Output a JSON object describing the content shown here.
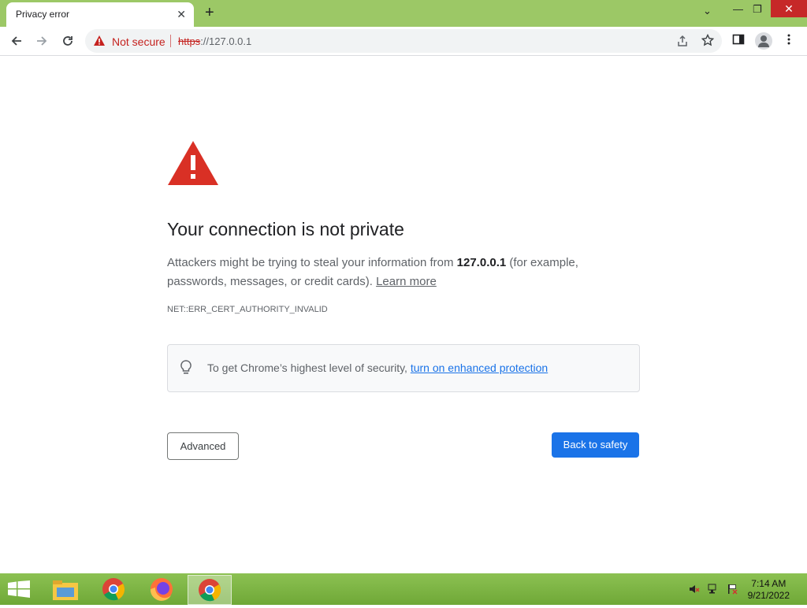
{
  "tab": {
    "title": "Privacy error",
    "close": "✕"
  },
  "new_tab": "+",
  "window": {
    "dropdown": "⌄",
    "minimize": "—",
    "restore": "❐",
    "close": "✕"
  },
  "omnibox": {
    "security_label": "Not secure",
    "scheme": "https",
    "rest": "://127.0.0.1"
  },
  "content": {
    "heading": "Your connection is not private",
    "explain_pre": "Attackers might be trying to steal your information from ",
    "host": "127.0.0.1",
    "explain_post": " (for example, passwords, messages, or credit cards). ",
    "learn_more": "Learn more",
    "error_code": "NET::ERR_CERT_AUTHORITY_INVALID",
    "security_text": "To get Chrome’s highest level of security, ",
    "security_link": "turn on enhanced protection",
    "advanced_button": "Advanced",
    "back_button": "Back to safety"
  },
  "clock": {
    "time": "7:14 AM",
    "date": "9/21/2022"
  },
  "colors": {
    "title_bar": "#9cc866",
    "warning_red": "#d93025",
    "primary_blue": "#1a73e8",
    "taskbar": "#7cb342"
  }
}
